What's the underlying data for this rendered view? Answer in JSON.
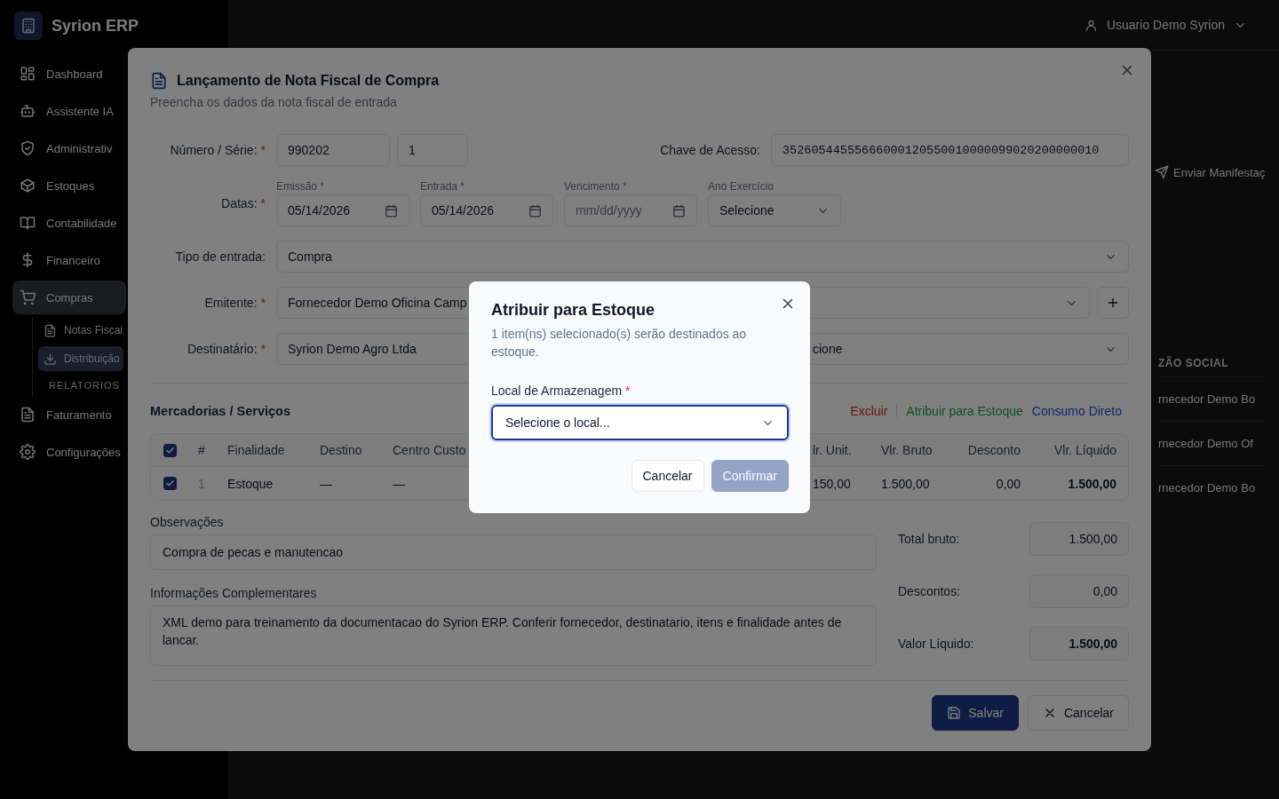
{
  "sidebar": {
    "brand": "Syrion ERP",
    "items": [
      {
        "label": "Dashboard",
        "selected": false
      },
      {
        "label": "Assistente IA",
        "selected": false
      },
      {
        "label": "Administrativ",
        "selected": false
      },
      {
        "label": "Estoques",
        "selected": false
      },
      {
        "label": "Contabilidade",
        "selected": false
      },
      {
        "label": "Financeiro",
        "selected": false
      },
      {
        "label": "Compras",
        "selected": true,
        "children": [
          {
            "label": "Notas Fiscai",
            "selected": false
          },
          {
            "label": "Distribuição",
            "selected": true
          }
        ],
        "section": "RELATORIOS"
      },
      {
        "label": "Faturamento",
        "selected": false
      },
      {
        "label": "Configurações",
        "selected": false
      }
    ]
  },
  "header": {
    "user": "Usuario Demo Syrion"
  },
  "page": {
    "action": "Enviar Manifestaç",
    "table": {
      "column": "ZÃO SOCIAL",
      "rows": [
        "rnecedor Demo Bo",
        "rnecedor Demo Of",
        "rnecedor Demo Bo"
      ]
    }
  },
  "modal": {
    "title": "Lançamento de Nota Fiscal de Compra",
    "subtitle": "Preencha os dados da nota fiscal de entrada",
    "numero": {
      "label": "Número / Série:",
      "mark": "*",
      "numero": "990202",
      "serie": "1"
    },
    "chave": {
      "label": "Chave de Acesso:",
      "value": "35260544555666000120550010000099020200000010"
    },
    "datas": {
      "label": "Datas:",
      "mark": "*",
      "fields": [
        {
          "label": "Emissão *",
          "value": "05/14/2026"
        },
        {
          "label": "Entrada *",
          "value": "05/14/2026"
        },
        {
          "label": "Vencimento *",
          "placeholder": "mm/dd/yyyy"
        }
      ],
      "ano": {
        "label": "Ano Exercício",
        "value": "Selecione"
      }
    },
    "tipo": {
      "label": "Tipo de entrada:",
      "value": "Compra"
    },
    "emitente": {
      "label": "Emitente:",
      "mark": "*",
      "value": "Fornecedor Demo Oficina Camp"
    },
    "destinatario": {
      "label": "Destinatário:",
      "mark": "*",
      "value": "Syrion Demo Agro Ltda",
      "second": "cione"
    },
    "items": {
      "title": "Mercadorias / Serviços",
      "actions": [
        {
          "label": "Excluir",
          "kind": "danger"
        },
        {
          "label": "Atribuir para Estoque",
          "kind": "success"
        },
        {
          "label": "Consumo Direto",
          "kind": "info"
        }
      ],
      "all_checked": true,
      "columns": [
        "#",
        "Finalidade",
        "Destino",
        "Centro Custo",
        "lr. Unit.",
        "Vlr. Bruto",
        "Desconto",
        "Vlr. Líquido"
      ],
      "rows": [
        {
          "checked": true,
          "cells": [
            "1",
            "Estoque",
            "—",
            "—",
            "150,00",
            "1.500,00",
            "0,00",
            "1.500,00"
          ]
        }
      ]
    },
    "observacoes": {
      "label": "Observações",
      "value": "Compra de pecas e manutencao"
    },
    "complementares": {
      "label": "Informações Complementares",
      "value": "XML demo para treinamento da documentacao do Syrion ERP. Conferir fornecedor, destinatario, itens e finalidade antes de lancar."
    },
    "totals": [
      {
        "label": "Total bruto:",
        "value": "1.500,00"
      },
      {
        "label": "Descontos:",
        "value": "0,00"
      },
      {
        "label": "Valor Líquido:",
        "value": "1.500,00"
      }
    ],
    "buttons": [
      {
        "label": "Salvar",
        "kind": "primary"
      },
      {
        "label": "Cancelar",
        "kind": "secondary"
      }
    ]
  },
  "dialog": {
    "title": "Atribuir para Estoque",
    "subtitle": "1 item(ns) selecionado(s) serão destinados ao estoque.",
    "field": {
      "label": "Local de Armazenagem",
      "mark": "*",
      "placeholder": "Selecione o local..."
    },
    "buttons": [
      {
        "label": "Cancelar",
        "kind": "secondary",
        "disabled": false
      },
      {
        "label": "Confirmar",
        "kind": "primary",
        "disabled": true
      }
    ]
  }
}
